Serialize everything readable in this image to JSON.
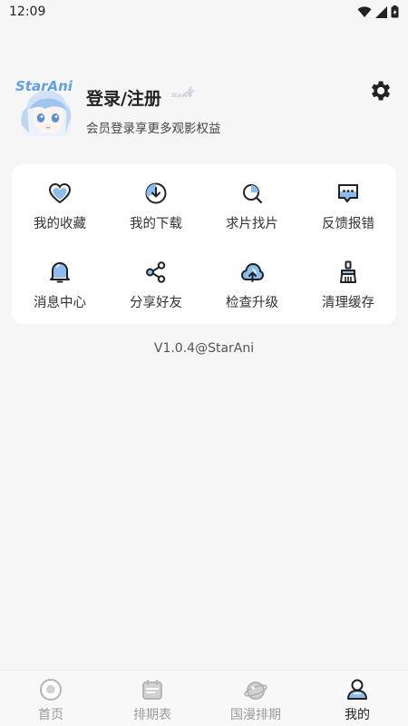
{
  "status_bar": {
    "time": "12:09",
    "icons": [
      "wifi-icon",
      "signal-icon",
      "battery-icon"
    ]
  },
  "profile": {
    "avatar_logo_text": "StarAni",
    "title": "登录/注册",
    "subtitle": "会员登录享更多观影权益",
    "settings_icon": "gear-icon"
  },
  "grid": {
    "items": [
      {
        "label": "我的收藏",
        "icon": "heart-icon"
      },
      {
        "label": "我的下载",
        "icon": "download-icon"
      },
      {
        "label": "求片找片",
        "icon": "search-icon"
      },
      {
        "label": "反馈报错",
        "icon": "feedback-icon"
      },
      {
        "label": "消息中心",
        "icon": "bell-icon"
      },
      {
        "label": "分享好友",
        "icon": "share-icon"
      },
      {
        "label": "检查升级",
        "icon": "cloud-upload-icon"
      },
      {
        "label": "清理缓存",
        "icon": "broom-icon"
      }
    ]
  },
  "version": "V1.0.4@StarAni",
  "tabbar": {
    "tabs": [
      {
        "label": "首页",
        "icon": "home-icon",
        "active": false
      },
      {
        "label": "排期表",
        "icon": "calendar-icon",
        "active": false
      },
      {
        "label": "国漫排期",
        "icon": "planet-icon",
        "active": false
      },
      {
        "label": "我的",
        "icon": "profile-icon",
        "active": true
      }
    ]
  },
  "colors": {
    "accent": "#7fb3ee",
    "text": "#222222",
    "inactive": "#9b9b9b",
    "background": "#f6f6f6",
    "card": "#ffffff"
  }
}
